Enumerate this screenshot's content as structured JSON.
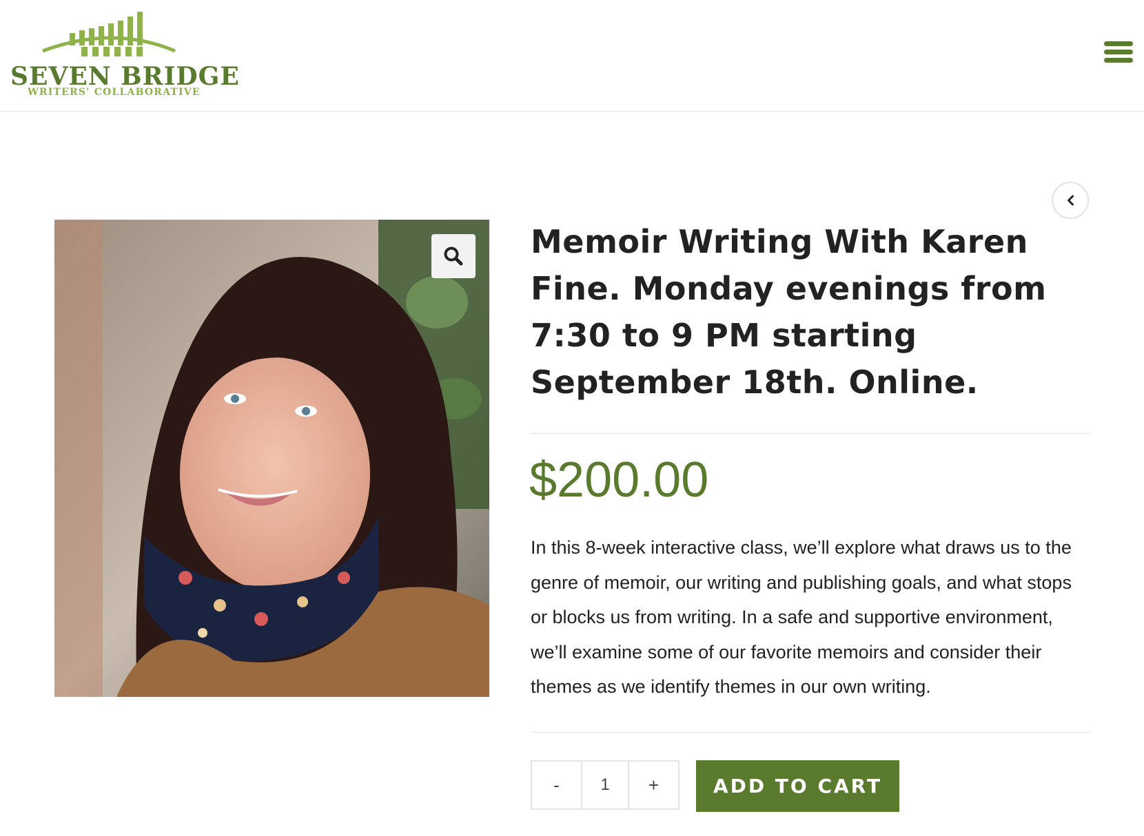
{
  "header": {
    "logo": {
      "name": "SEVEN BRIDGE",
      "tagline": "WRITERS' COLLABORATIVE"
    },
    "menu_icon": "hamburger-menu-icon"
  },
  "navigation": {
    "back_icon": "chevron-left-icon"
  },
  "product": {
    "image_alt": "Portrait photo of Karen Fine",
    "zoom_icon": "magnifier-icon",
    "title": "Memoir Writing With Karen Fine. Monday evenings from 7:30 to 9 PM starting September 18th. Online.",
    "price": "$200.00",
    "description": "In this 8-week interactive class, we’ll explore what draws us to the genre of memoir, our writing and publishing goals, and what stops or blocks us from writing. In a safe and supportive environment, we’ll examine some of our favorite memoirs and consider their themes as we identify themes in our own writing.",
    "quantity": {
      "decrement_label": "-",
      "value": "1",
      "increment_label": "+"
    },
    "add_to_cart_label": "ADD TO CART"
  },
  "colors": {
    "brand_green": "#5a7a2e",
    "logo_light_green": "#8fb24a"
  }
}
